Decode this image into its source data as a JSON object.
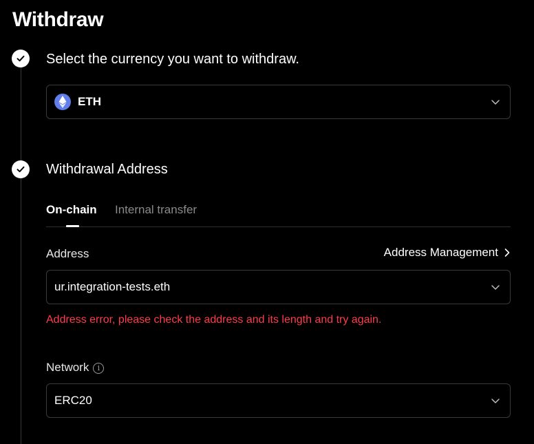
{
  "page": {
    "title": "Withdraw"
  },
  "steps": {
    "currency": {
      "title": "Select the currency you want to withdraw.",
      "selected": "ETH",
      "icon": "ethereum-icon",
      "icon_color": "#627eea"
    },
    "address": {
      "title": "Withdrawal Address",
      "tabs": [
        {
          "label": "On-chain",
          "active": true
        },
        {
          "label": "Internal transfer",
          "active": false
        }
      ],
      "address_label": "Address",
      "address_management": "Address Management",
      "address_value": "ur.integration-tests.eth",
      "error": "Address error, please check the address and its length and try again.",
      "error_color": "#ff3b4a",
      "network_label": "Network",
      "network_value": "ERC20"
    }
  }
}
